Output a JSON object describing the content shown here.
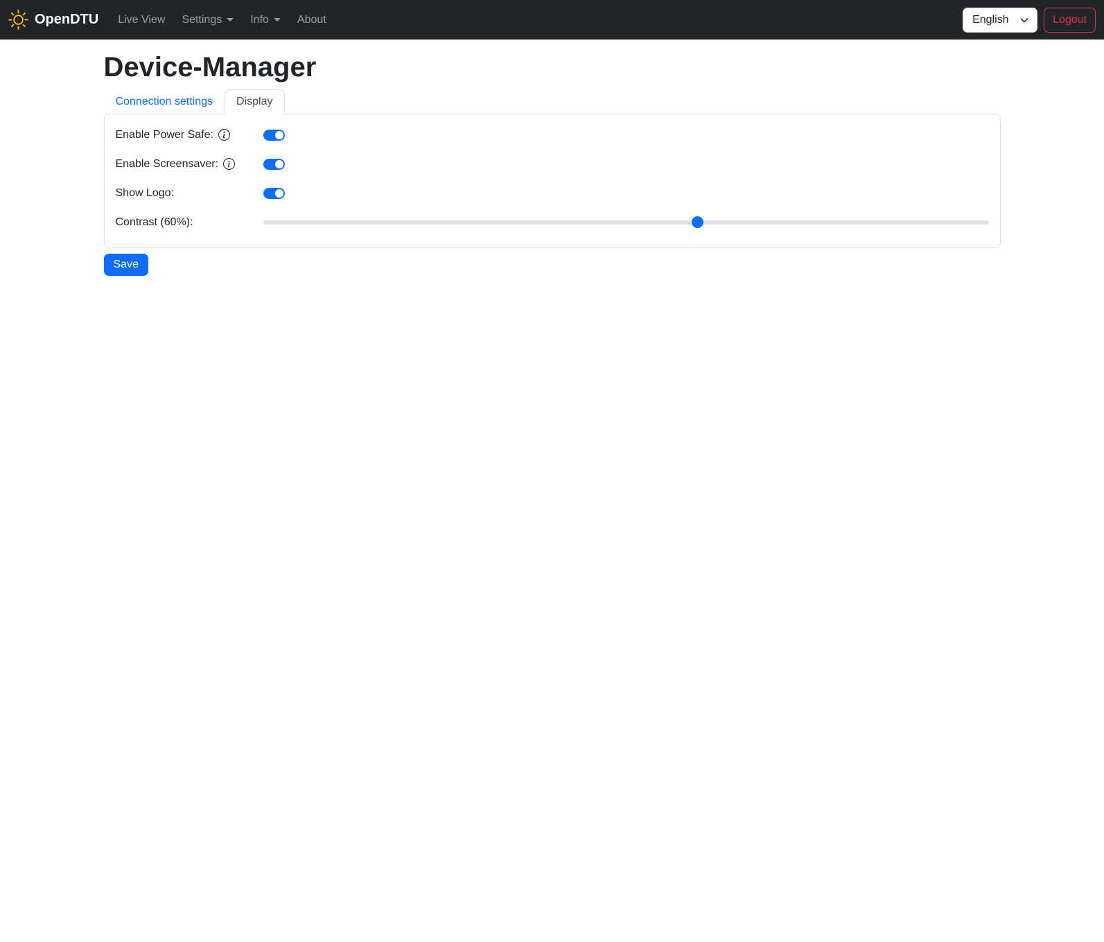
{
  "navbar": {
    "brand": "OpenDTU",
    "items": [
      {
        "label": "Live View",
        "dropdown": false
      },
      {
        "label": "Settings",
        "dropdown": true
      },
      {
        "label": "Info",
        "dropdown": true
      },
      {
        "label": "About",
        "dropdown": false
      }
    ],
    "language": {
      "value": "English"
    },
    "logout_label": "Logout"
  },
  "page": {
    "title": "Device-Manager"
  },
  "tabs": [
    {
      "label": "Connection settings",
      "active": false
    },
    {
      "label": "Display",
      "active": true
    }
  ],
  "form": {
    "fields": [
      {
        "label": "Enable Power Safe:",
        "type": "switch",
        "checked": true,
        "has_info_icon": true
      },
      {
        "label": "Enable Screensaver:",
        "type": "switch",
        "checked": true,
        "has_info_icon": true
      },
      {
        "label": "Show Logo:",
        "type": "switch",
        "checked": true,
        "has_info_icon": false
      },
      {
        "label": "Contrast (60%):",
        "type": "range",
        "value": 60,
        "min": 0,
        "max": 100
      }
    ],
    "save_label": "Save"
  },
  "colors": {
    "accent": "#0d6efd",
    "navbar_bg": "#212529",
    "navbar_link": "rgba(255,255,255,0.55)",
    "danger": "#dc3545",
    "brand_icon": "#ffc107",
    "card_border": "#dee2e6",
    "slider_track": "#dee2e6"
  }
}
